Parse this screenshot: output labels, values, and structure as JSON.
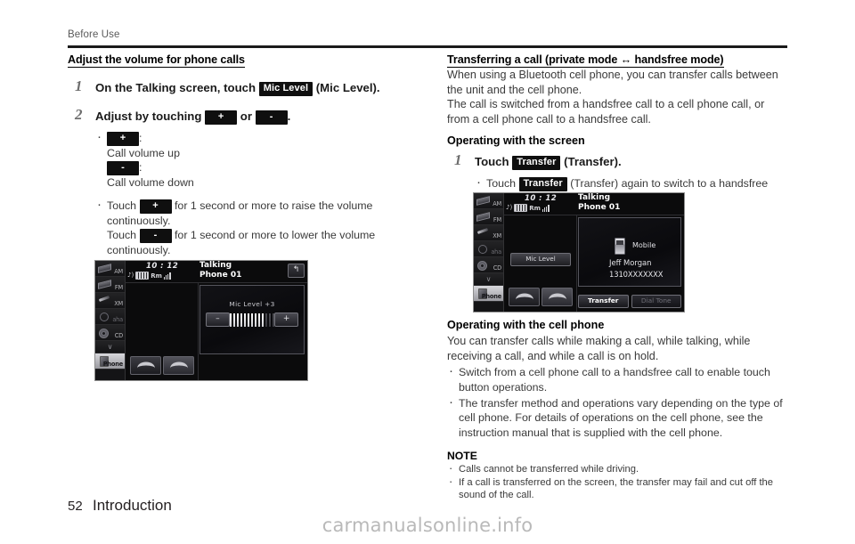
{
  "page": {
    "running_head": "Before Use",
    "page_number": "52",
    "section": "Introduction",
    "watermark": "carmanualsonline.info"
  },
  "left_column": {
    "section_title": "Adjust the volume for phone calls",
    "steps": [
      {
        "num": "1",
        "text_before": "On the Talking screen, touch",
        "keycap": "Mic Level",
        "text_after": "(Mic Level)."
      },
      {
        "num": "2",
        "text_before": "Adjust by touching",
        "keycap_plus": "+",
        "conjunction": "or",
        "keycap_minus": "-",
        "text_after": "."
      }
    ],
    "bullets": [
      {
        "key": "+",
        "colon": ":",
        "desc": "Call volume up",
        "key2": "-",
        "colon2": ":",
        "desc2": "Call volume down"
      },
      {
        "touch1_pre": "Touch",
        "touch1_key": "+",
        "touch1_post": "for 1 second or more to raise the volume continuously.",
        "touch2_pre": "Touch",
        "touch2_key": "-",
        "touch2_post": "for 1 second or more to lower the volume continuously."
      }
    ]
  },
  "right_column": {
    "section_title": "Transferring a call (private mode ↔ handsfree mode)",
    "paragraphs": [
      "When using a Bluetooth cell phone, you can transfer calls between the unit and the cell phone.",
      "The call is switched from a handsfree call to a cell phone call, or from a cell phone call to a handsfree call."
    ],
    "subheading_screen": "Operating with the screen",
    "step": {
      "num": "1",
      "text_before": "Touch",
      "keycap": "Transfer",
      "text_after": "(Transfer)."
    },
    "step_bullet": {
      "pre": "Touch",
      "keycap": "Transfer",
      "post": "(Transfer) again to switch to a handsfree call."
    },
    "subheading_phone": "Operating with the cell phone",
    "paragraph_phone": "You can transfer calls while making a call, while talking, while receiving a call, and while a call is on hold.",
    "phone_bullets": [
      "Switch from a cell phone call to a handsfree call to enable touch button operations.",
      "The transfer method and operations vary depending on the type of cell phone. For details of operations on the cell phone, see the instruction manual that is supplied with the cell phone."
    ],
    "note_heading": "NOTE",
    "note_bullets": [
      "Calls cannot be transferred while driving.",
      "If a call is transferred on the screen, the transfer may fail and cut off the sound of the call."
    ]
  },
  "device_left": {
    "sources": [
      {
        "label": "AM",
        "icon": "tape-icon",
        "active": false
      },
      {
        "label": "FM",
        "icon": "tape-icon",
        "active": false
      },
      {
        "label": "XM",
        "icon": "antenna-icon",
        "active": false
      },
      {
        "label": "aha",
        "icon": "circle-icon",
        "active": false
      },
      {
        "label": "CD",
        "icon": "disc-icon",
        "active": false
      }
    ],
    "chevron": "∨",
    "active_source": "Phone",
    "clock": "10 : 12",
    "status_roaming": "Rm",
    "call_state": "Talking",
    "call_line2": "Phone 01",
    "return_icon": "↰",
    "mic_label": "Mic Level   +3",
    "minus": "–",
    "plus": "+",
    "bar_total": 13,
    "bar_filled": 10
  },
  "device_right": {
    "sources": [
      {
        "label": "AM",
        "icon": "tape-icon",
        "active": false
      },
      {
        "label": "FM",
        "icon": "tape-icon",
        "active": false
      },
      {
        "label": "XM",
        "icon": "antenna-icon",
        "active": false
      },
      {
        "label": "aha",
        "icon": "circle-icon",
        "active": false
      },
      {
        "label": "CD",
        "icon": "disc-icon",
        "active": false
      }
    ],
    "chevron": "∨",
    "active_source": "Phone",
    "clock": "10 : 12",
    "status_roaming": "Rm",
    "call_state": "Talking",
    "call_line2": "Phone 01",
    "mic_level_button": "Mic Level",
    "contact_type": "Mobile",
    "contact_name": "Jeff Morgan",
    "contact_number": "1310XXXXXXX",
    "transfer_button": "Transfer",
    "dial_tone_button": "Dial Tone"
  },
  "colors": {
    "ink": "#231f20",
    "body_text": "#3a3a3a",
    "keycap_bg": "#0f0f0f",
    "rule": "#1a1a1a",
    "watermark": "#b9b9b9"
  }
}
